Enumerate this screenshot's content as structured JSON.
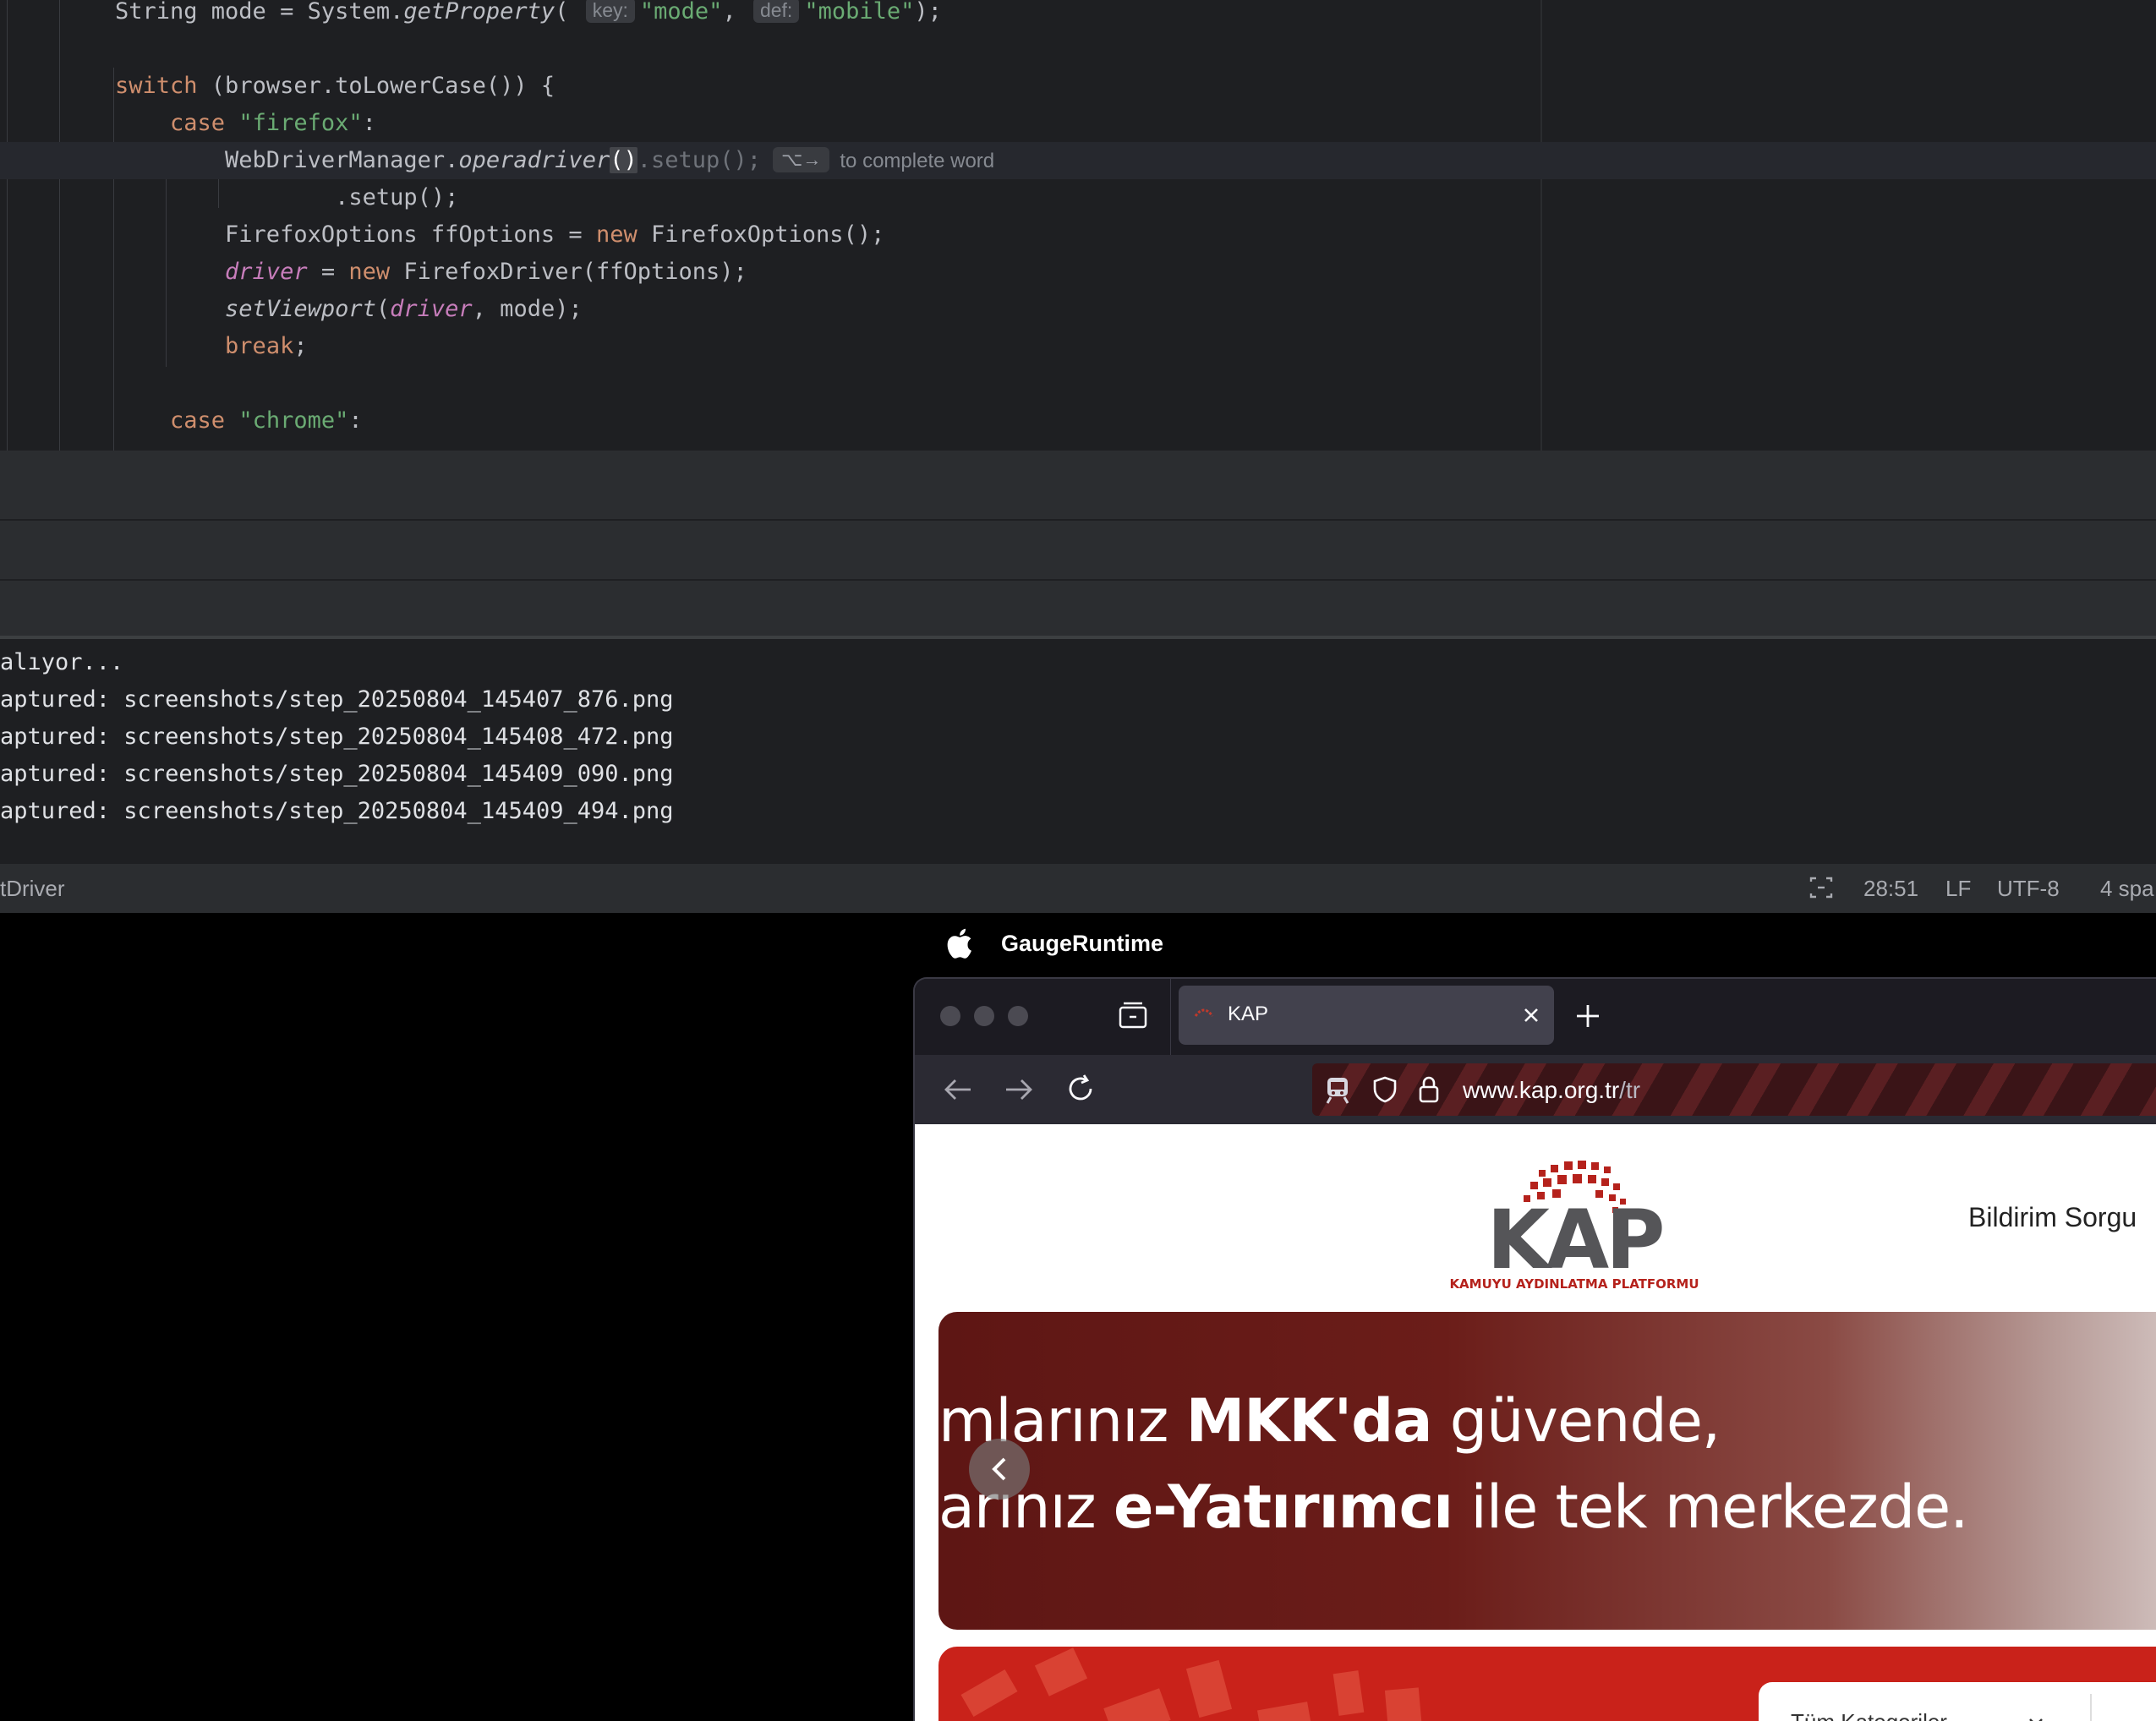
{
  "editor": {
    "lines": [
      {
        "segments": [
          [
            "plain",
            "String mode = System."
          ],
          [
            "it",
            "getProperty"
          ],
          [
            "plain",
            "( "
          ],
          [
            "hint",
            "key:"
          ],
          [
            "str",
            "\"mode\""
          ],
          [
            "plain",
            ", "
          ],
          [
            "hint",
            "def:"
          ],
          [
            "str",
            "\"mobile\""
          ],
          [
            "plain",
            ");"
          ]
        ]
      },
      {
        "segments": []
      },
      {
        "segments": [
          [
            "kw",
            "switch"
          ],
          [
            "plain",
            " (browser.toLowerCase()) {"
          ]
        ]
      },
      {
        "segments": [
          [
            "plain",
            "    "
          ],
          [
            "kw",
            "case "
          ],
          [
            "str",
            "\"firefox\""
          ],
          [
            "plain",
            ":"
          ]
        ]
      },
      {
        "segments": [
          [
            "plain",
            "        WebDriverManager."
          ],
          [
            "it",
            "operadriver"
          ],
          [
            "caret",
            "()"
          ],
          [
            "ghost",
            ".setup();"
          ],
          [
            "ckey",
            "⌥→"
          ],
          [
            "chint",
            "to complete word"
          ]
        ]
      },
      {
        "segments": [
          [
            "plain",
            "                .setup();"
          ]
        ]
      },
      {
        "segments": [
          [
            "plain",
            "        FirefoxOptions ffOptions = "
          ],
          [
            "kw",
            "new "
          ],
          [
            "plain",
            "FirefoxOptions();"
          ]
        ]
      },
      {
        "segments": [
          [
            "plain",
            "        "
          ],
          [
            "fld",
            "driver"
          ],
          [
            "plain",
            " = "
          ],
          [
            "kw",
            "new "
          ],
          [
            "plain",
            "FirefoxDriver(ffOptions);"
          ]
        ]
      },
      {
        "segments": [
          [
            "plain",
            "        "
          ],
          [
            "it",
            "setViewport"
          ],
          [
            "plain",
            "("
          ],
          [
            "fld",
            "driver"
          ],
          [
            "plain",
            ", mode);"
          ]
        ]
      },
      {
        "segments": [
          [
            "plain",
            "        "
          ],
          [
            "kw",
            "break"
          ],
          [
            "plain",
            ";"
          ]
        ]
      },
      {
        "segments": []
      },
      {
        "segments": [
          [
            "plain",
            "    "
          ],
          [
            "kw",
            "case "
          ],
          [
            "str",
            "\"chrome\""
          ],
          [
            "plain",
            ":"
          ]
        ]
      }
    ]
  },
  "console": {
    "lines": [
      "alıyor...",
      "aptured: screenshots/step_20250804_145407_876.png",
      "aptured: screenshots/step_20250804_145408_472.png",
      "aptured: screenshots/step_20250804_145409_090.png",
      "aptured: screenshots/step_20250804_145409_494.png"
    ]
  },
  "statusbar": {
    "left": "tDriver",
    "position": "28:51",
    "line_ending": "LF",
    "encoding": "UTF-8",
    "indent": "4 spa"
  },
  "menubar": {
    "app_name": "GaugeRuntime"
  },
  "browser": {
    "tab_title": "KAP",
    "url_host": "www.kap.org.tr",
    "url_path": "/tr"
  },
  "page": {
    "logo_text": "KAP",
    "logo_subtitle": "KAMUYU AYDINLATMA PLATFORMU",
    "nav_item": "Bildirim Sorgu",
    "hero": {
      "line1_pre": "mlarınız ",
      "line1_bold": "MKK'da",
      "line1_post": " güvende,",
      "line2_pre": "arınız ",
      "line2_bold": "e-Yatırımcı",
      "line2_post": " ile tek merkezde."
    },
    "filter_label": "Tüm Kategoriler"
  },
  "colors": {
    "ide_bg": "#1e1f22",
    "keyword": "#cf8e6d",
    "string": "#6aab73",
    "field": "#c77dbb",
    "kap_red": "#b5221c"
  }
}
